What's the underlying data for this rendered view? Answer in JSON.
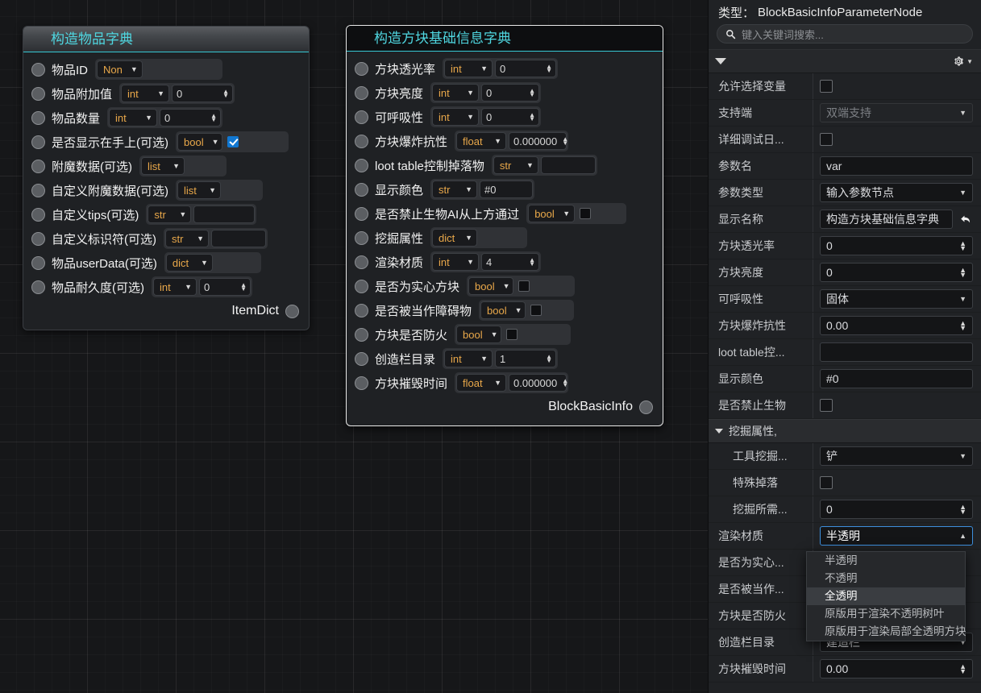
{
  "canvas": {
    "nodes": [
      {
        "title": "构造物品字典",
        "output_label": "ItemDict",
        "selected": false,
        "rows": [
          {
            "label": "物品ID",
            "widget": "combo_blank",
            "type": "Non",
            "value": ""
          },
          {
            "label": "物品附加值",
            "widget": "combo_spin",
            "type": "int",
            "value": "0"
          },
          {
            "label": "物品数量",
            "widget": "combo_spin",
            "type": "int",
            "value": "0"
          },
          {
            "label": "是否显示在手上(可选)",
            "widget": "combo_check",
            "type": "bool",
            "checked": true
          },
          {
            "label": "附魔数据(可选)",
            "widget": "combo_blank",
            "type": "list",
            "value": ""
          },
          {
            "label": "自定义附魔数据(可选)",
            "widget": "combo_blank",
            "type": "list",
            "value": ""
          },
          {
            "label": "自定义tips(可选)",
            "widget": "combo_text",
            "type": "str",
            "value": ""
          },
          {
            "label": "自定义标识符(可选)",
            "widget": "combo_text",
            "type": "str",
            "value": ""
          },
          {
            "label": "物品userData(可选)",
            "widget": "combo_blank",
            "type": "dict",
            "value": ""
          },
          {
            "label": "物品耐久度(可选)",
            "widget": "combo_spin",
            "type": "int",
            "value": "0"
          }
        ]
      },
      {
        "title": "构造方块基础信息字典",
        "output_label": "BlockBasicInfo",
        "selected": true,
        "rows": [
          {
            "label": "方块透光率",
            "widget": "combo_spin",
            "type": "int",
            "value": "0"
          },
          {
            "label": "方块亮度",
            "widget": "combo_spin",
            "type": "int",
            "value": "0"
          },
          {
            "label": "可呼吸性",
            "widget": "combo_spin",
            "type": "int",
            "value": "0"
          },
          {
            "label": "方块爆炸抗性",
            "widget": "combo_spin",
            "type": "float",
            "value": "0.000000"
          },
          {
            "label": "loot table控制掉落物",
            "widget": "combo_text",
            "type": "str",
            "value": ""
          },
          {
            "label": "显示颜色",
            "widget": "combo_text",
            "type": "str",
            "value": "#0"
          },
          {
            "label": "是否禁止生物AI从上方通过",
            "widget": "combo_check",
            "type": "bool",
            "checked": false
          },
          {
            "label": "挖掘属性",
            "widget": "combo_blank",
            "type": "dict",
            "value": ""
          },
          {
            "label": "渲染材质",
            "widget": "combo_spin",
            "type": "int",
            "value": "4"
          },
          {
            "label": "是否为实心方块",
            "widget": "combo_check",
            "type": "bool",
            "checked": false
          },
          {
            "label": "是否被当作障碍物",
            "widget": "combo_check",
            "type": "bool",
            "checked": false
          },
          {
            "label": "方块是否防火",
            "widget": "combo_check",
            "type": "bool",
            "checked": false
          },
          {
            "label": "创造栏目录",
            "widget": "combo_spin",
            "type": "int",
            "value": "1"
          },
          {
            "label": "方块摧毁时间",
            "widget": "combo_spin",
            "type": "float",
            "value": "0.000000"
          }
        ]
      }
    ]
  },
  "panel": {
    "type_prefix": "类型：",
    "type_value": "BlockBasicInfoParameterNode",
    "search": {
      "placeholder": "键入关键词搜索...",
      "value": "",
      "icon": "search-icon"
    },
    "section": {
      "collapse_icon": "triangle-down-icon",
      "gear_icon": "gear-icon"
    },
    "props": [
      {
        "label": "允许选择变量",
        "kind": "checkbox",
        "checked": false
      },
      {
        "label": "支持端",
        "kind": "select_disabled",
        "value": "双端支持"
      },
      {
        "label": "详细调试日...",
        "kind": "checkbox",
        "checked": false
      },
      {
        "label": "参数名",
        "kind": "text",
        "value": "var"
      },
      {
        "label": "参数类型",
        "kind": "select",
        "value": "输入参数节点"
      },
      {
        "label": "显示名称",
        "kind": "text_revert",
        "value": "构造方块基础信息字典",
        "revert_icon": "undo-arrow-icon"
      },
      {
        "label": "方块透光率",
        "kind": "spin",
        "value": "0"
      },
      {
        "label": "方块亮度",
        "kind": "spin",
        "value": "0"
      },
      {
        "label": "可呼吸性",
        "kind": "select",
        "value": "固体"
      },
      {
        "label": "方块爆炸抗性",
        "kind": "spin",
        "value": "0.00"
      },
      {
        "label": "loot table控...",
        "kind": "text",
        "value": ""
      },
      {
        "label": "显示颜色",
        "kind": "text",
        "value": "#0"
      },
      {
        "label": "是否禁止生物",
        "kind": "checkbox",
        "checked": false
      }
    ],
    "group": {
      "header": "挖掘属性,",
      "collapse_icon": "triangle-down-icon",
      "props": [
        {
          "label": "工具挖掘...",
          "kind": "select",
          "value": "铲",
          "indent": true
        },
        {
          "label": "特殊掉落",
          "kind": "checkbox",
          "checked": false,
          "indent": true
        },
        {
          "label": "挖掘所需...",
          "kind": "spin",
          "value": "0",
          "indent": true
        }
      ]
    },
    "props_after": [
      {
        "label": "渲染材质",
        "kind": "select_open",
        "value": "半透明"
      },
      {
        "label": "是否为实心...",
        "kind": "hidden",
        "value": ""
      },
      {
        "label": "是否被当作...",
        "kind": "hidden",
        "value": ""
      },
      {
        "label": "方块是否防火",
        "kind": "hidden",
        "value": ""
      },
      {
        "label": "创造栏目录",
        "kind": "select_occluded",
        "value": "建造栏"
      },
      {
        "label": "方块摧毁时间",
        "kind": "spin",
        "value": "0.00"
      }
    ],
    "dropdown": {
      "options": [
        "半透明",
        "不透明",
        "全透明",
        "原版用于渲染不透明树叶",
        "原版用于渲染局部全透明方块"
      ],
      "selected_index": 2
    }
  },
  "colors": {
    "accent_cyan": "#4fd6e0",
    "type_orange": "#e9a84a",
    "checkbox_blue": "#1177d1",
    "focus_blue": "#3d8fdd",
    "canvas_bg": "#161719",
    "panel_bg": "#202225"
  }
}
